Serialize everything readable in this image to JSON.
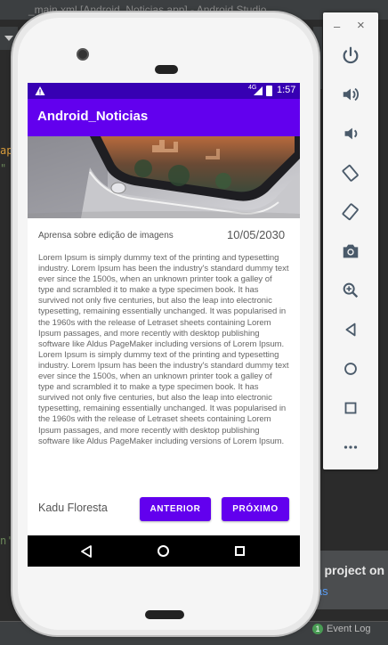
{
  "ide": {
    "window_title": "_main.xml [Android_Noticias.app] - Android Studio",
    "code_fragment_a": "ap",
    "code_fragment_b": "\"",
    "code_fragment_c": "n'",
    "notification_title": "d project on G",
    "notification_link": "ias",
    "event_log_label": "Event Log",
    "event_log_count": "1"
  },
  "emulator_panel": {
    "minimize_label": "–",
    "close_label": "×",
    "buttons": [
      {
        "icon": "power-icon"
      },
      {
        "icon": "volume-up-icon"
      },
      {
        "icon": "volume-down-icon"
      },
      {
        "icon": "rotate-left-icon"
      },
      {
        "icon": "rotate-right-icon"
      },
      {
        "icon": "camera-icon"
      },
      {
        "icon": "zoom-icon"
      },
      {
        "icon": "back-icon"
      },
      {
        "icon": "home-icon"
      },
      {
        "icon": "overview-icon"
      },
      {
        "icon": "more-icon"
      }
    ]
  },
  "statusbar": {
    "network_label": "4G",
    "time": "1:57"
  },
  "app": {
    "title": "Android_Noticias",
    "caption": "Aprensa sobre edição de imagens",
    "date": "10/05/2030",
    "body": "Lorem Ipsum is simply dummy text of the printing and typesetting industry. Lorem Ipsum has been the industry's standard dummy text ever since the 1500s, when an unknown printer took a galley of type and scrambled it to make a type specimen book. It has survived not only five centuries, but also the leap into electronic typesetting, remaining essentially unchanged. It was popularised in the 1960s with the release of Letraset sheets containing Lorem Ipsum passages, and more recently with desktop publishing software like Aldus PageMaker including versions of Lorem Ipsum. Lorem Ipsum is simply dummy text of the printing and typesetting industry. Lorem Ipsum has been the industry's standard dummy text ever since the 1500s, when an unknown printer took a galley of type and scrambled it to make a type specimen book. It has survived not only five centuries, but also the leap into electronic typesetting, remaining essentially unchanged. It was popularised in the 1960s with the release of Letraset sheets containing Lorem Ipsum passages, and more recently with desktop publishing software like Aldus PageMaker including versions of Lorem Ipsum.",
    "author": "Kadu Floresta",
    "prev_button": "ANTERIOR",
    "next_button": "PRÓXIMO"
  },
  "colors": {
    "primary": "#6200ee",
    "primary_dark": "#3700b3"
  }
}
